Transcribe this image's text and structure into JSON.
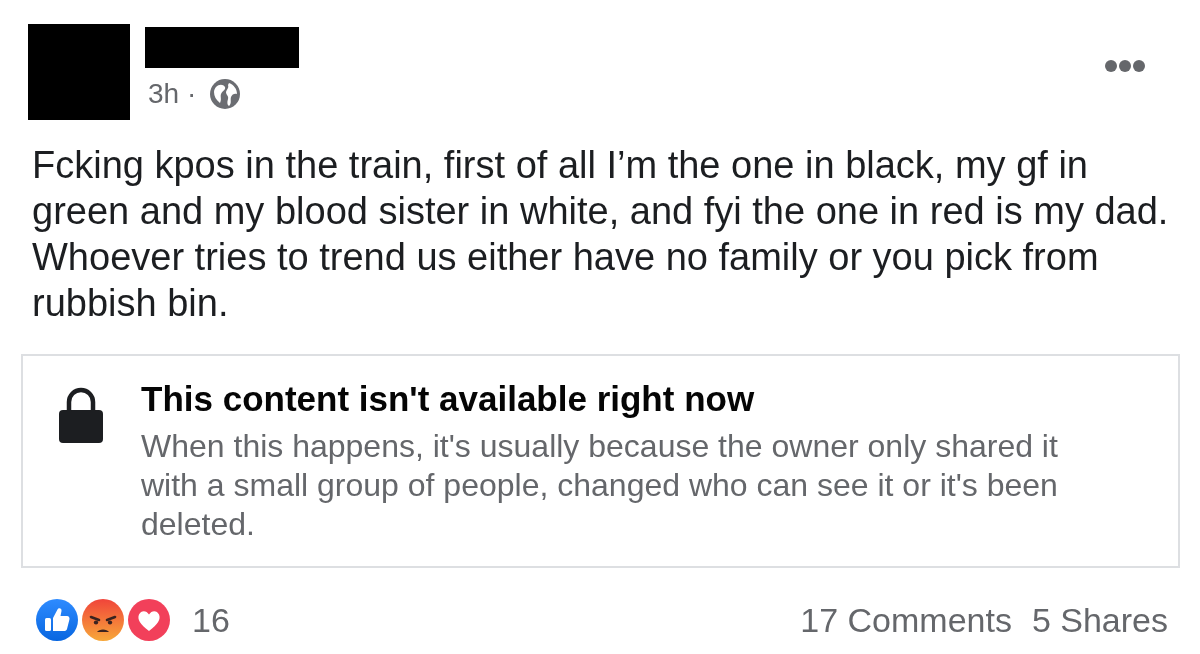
{
  "post": {
    "time": "3h ·",
    "text": "Fcking kpos in the train, first of all I’m the one in black, my gf in green and my blood sister in white, and fyi the one in red is my dad. Whoever tries to trend us either have no family or you pick from rubbish bin."
  },
  "attachment": {
    "title": "This content isn't available right now",
    "description": "When this happens, it's usually because the owner only shared it with a small group of people, changed who can see it or it's been deleted."
  },
  "footer": {
    "reactions": [
      {
        "kind": "like"
      },
      {
        "kind": "angry"
      },
      {
        "kind": "love"
      }
    ],
    "reaction_count": "16",
    "comments": "17 Comments",
    "shares": "5 Shares"
  }
}
